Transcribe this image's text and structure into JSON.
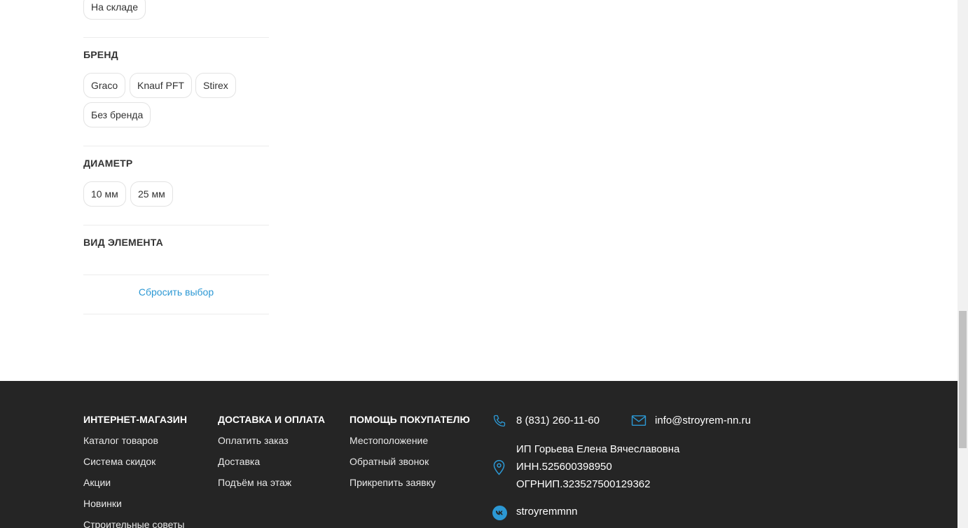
{
  "filters": {
    "availability_chip": "На складе",
    "brand": {
      "title": "БРЕНД",
      "options": [
        "Graco",
        "Knauf PFT",
        "Stirex",
        "Без бренда"
      ]
    },
    "diameter": {
      "title": "ДИАМЕТР",
      "options": [
        "10 мм",
        "25 мм"
      ]
    },
    "element_type": {
      "title": "ВИД ЭЛЕМЕНТА"
    },
    "reset_label": "Сбросить выбор"
  },
  "footer": {
    "shop": {
      "title": "ИНТЕРНЕТ-МАГАЗИН",
      "links": [
        "Каталог товаров",
        "Система скидок",
        "Акции",
        "Новинки",
        "Строительные советы"
      ]
    },
    "delivery": {
      "title": "ДОСТАВКА И ОПЛАТА",
      "links": [
        "Оплатить заказ",
        "Доставка",
        "Подъём на этаж"
      ]
    },
    "help": {
      "title": "ПОМОЩЬ ПОКУПАТЕЛЮ",
      "links": [
        "Местоположение",
        "Обратный звонок",
        "Прикрепить заявку"
      ]
    },
    "contacts": {
      "phone": "8 (831) 260-11-60",
      "email": "info@stroyrem-nn.ru",
      "company": "ИП Горьева Елена Вячеславовна",
      "inn": "ИНН.525600398950",
      "ogrnip": "ОГРНИП.323527500129362",
      "vk": "stroyremmnn"
    },
    "icons": {
      "phone": "phone-icon",
      "email": "mail-icon",
      "location": "location-pin-icon",
      "vk": "vk-icon"
    },
    "accent_color": "#2c98d4",
    "background_color": "#252525"
  }
}
